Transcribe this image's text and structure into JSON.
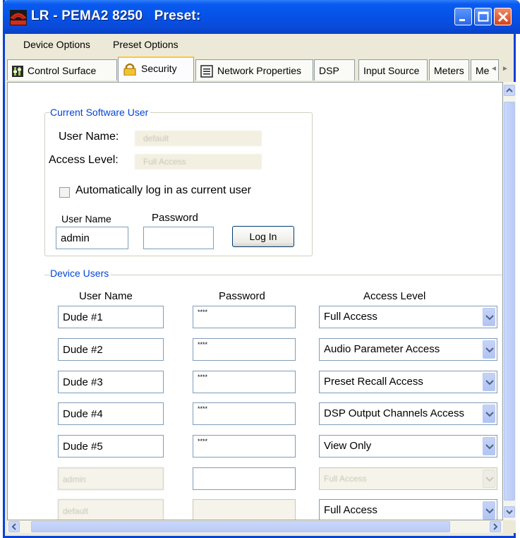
{
  "window": {
    "title": "LR - PEMA2 8250   Preset:"
  },
  "menu": {
    "items": [
      "Device Options",
      "Preset Options"
    ]
  },
  "tabs": [
    {
      "label": "Control Surface",
      "icon": "control-surface-icon"
    },
    {
      "label": "Security",
      "icon": "lock-icon",
      "active": true
    },
    {
      "label": "Network Properties",
      "icon": "network-icon"
    },
    {
      "label": "DSP"
    },
    {
      "label": "Input Source"
    },
    {
      "label": "Meters"
    },
    {
      "label": "Me"
    }
  ],
  "current_user": {
    "group_label": "Current Software User",
    "user_name_label": "User Name:",
    "user_name_value": "default",
    "access_level_label": "Access Level:",
    "access_level_value": "Full Access",
    "auto_login_label": "Automatically log in as current user",
    "auto_login_checked": false,
    "login_user_label": "User Name",
    "login_user_value": "admin",
    "login_password_label": "Password",
    "login_password_value": "",
    "login_button": "Log In"
  },
  "device_users": {
    "group_label": "Device Users",
    "col_user": "User Name",
    "col_password": "Password",
    "col_access": "Access Level",
    "rows": [
      {
        "user": "Dude #1",
        "password": "****",
        "access": "Full Access",
        "enabled": true
      },
      {
        "user": "Dude #2",
        "password": "****",
        "access": "Audio Parameter Access",
        "enabled": true
      },
      {
        "user": "Dude #3",
        "password": "****",
        "access": "Preset Recall Access",
        "enabled": true
      },
      {
        "user": "Dude #4",
        "password": "****",
        "access": "DSP Output Channels Access",
        "enabled": true
      },
      {
        "user": "Dude #5",
        "password": "****",
        "access": "View Only",
        "enabled": true
      },
      {
        "user": "admin",
        "password": "",
        "access": "Full Access",
        "enabled": false
      },
      {
        "user": "default",
        "password": "",
        "access": "Full Access",
        "enabled": false,
        "access_enabled": true
      }
    ]
  },
  "colors": {
    "titlebar": "#0553e8",
    "group_label": "#0046d5",
    "active_tab_accent": "#ffc73c"
  }
}
